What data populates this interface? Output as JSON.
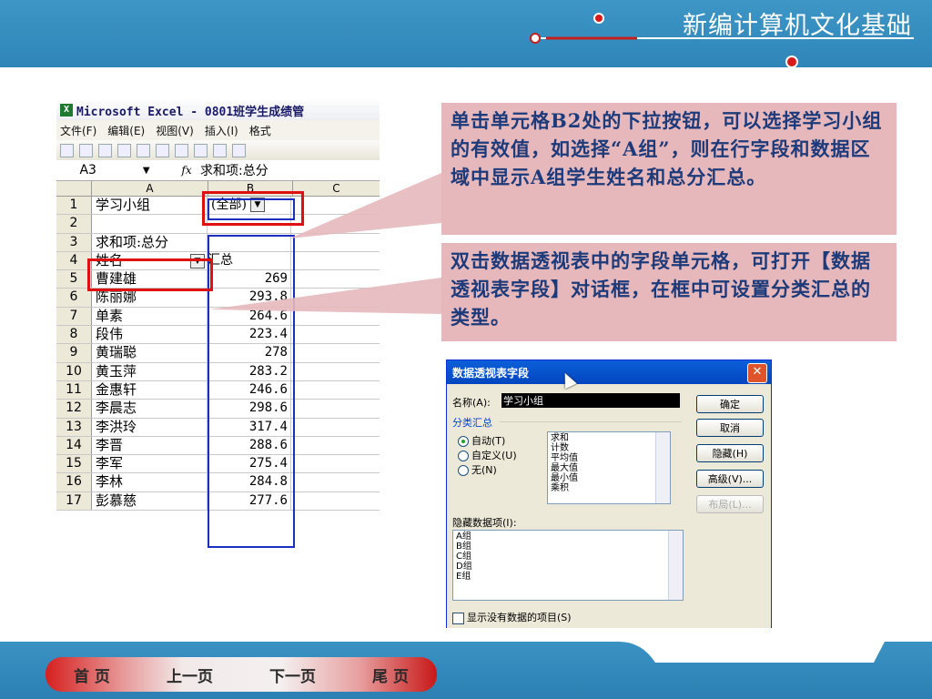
{
  "brand": "新编计算机文化基础",
  "excel": {
    "title": "Microsoft Excel - 0801班学生成绩管",
    "menu": [
      "文件(F)",
      "编辑(E)",
      "视图(V)",
      "插入(I)",
      "格式"
    ],
    "namebox": "A3",
    "formula": "求和项:总分",
    "col_headers": [
      "A",
      "B",
      "C"
    ],
    "rows": [
      {
        "n": "1",
        "a": "学习小组",
        "b": "(全部)"
      },
      {
        "n": "2",
        "a": "",
        "b": ""
      },
      {
        "n": "3",
        "a": "求和项:总分",
        "b": ""
      },
      {
        "n": "4",
        "a": "姓名",
        "b": "汇总"
      },
      {
        "n": "5",
        "a": "曹建雄",
        "b": "269"
      },
      {
        "n": "6",
        "a": "陈丽娜",
        "b": "293.8"
      },
      {
        "n": "7",
        "a": "单素",
        "b": "264.6"
      },
      {
        "n": "8",
        "a": "段伟",
        "b": "223.4"
      },
      {
        "n": "9",
        "a": "黄瑞聪",
        "b": "278"
      },
      {
        "n": "10",
        "a": "黄玉萍",
        "b": "283.2"
      },
      {
        "n": "11",
        "a": "金惠轩",
        "b": "246.6"
      },
      {
        "n": "12",
        "a": "李晨志",
        "b": "298.6"
      },
      {
        "n": "13",
        "a": "李洪玲",
        "b": "317.4"
      },
      {
        "n": "14",
        "a": "李晋",
        "b": "288.6"
      },
      {
        "n": "15",
        "a": "李军",
        "b": "275.4"
      },
      {
        "n": "16",
        "a": "李林",
        "b": "284.8"
      },
      {
        "n": "17",
        "a": "彭慕慈",
        "b": "277.6"
      }
    ]
  },
  "notes": {
    "note1": "单击单元格B2处的下拉按钮，可以选择学习小组的有效值，如选择“A组”，则在行字段和数据区域中显示A组学生姓名和总分汇总。",
    "note2": "双击数据透视表中的字段单元格，可打开【数据透视表字段】对话框，在框中可设置分类汇总的类型。"
  },
  "dialog": {
    "title": "数据透视表字段",
    "name_label": "名称(A):",
    "name_value": "学习小组",
    "subtotal_label": "分类汇总",
    "radio_auto": "自动(T)",
    "radio_custom": "自定义(U)",
    "radio_none": "无(N)",
    "functions": [
      "求和",
      "计数",
      "平均值",
      "最大值",
      "最小值",
      "乘积"
    ],
    "hidden_label": "隐藏数据项(I):",
    "hidden_items": [
      "A组",
      "B组",
      "C组",
      "D组",
      "E组"
    ],
    "show_empty": "显示没有数据的项目(S)",
    "btn_ok": "确定",
    "btn_cancel": "取消",
    "btn_hide": "隐藏(H)",
    "btn_advanced": "高级(V)...",
    "btn_layout": "布局(L)..."
  },
  "nav": {
    "home": "首 页",
    "prev": "上一页",
    "next": "下一页",
    "last": "尾 页"
  },
  "colors": {
    "header_blue": "#3d96c6",
    "note_pink": "#e6b8bb",
    "note_text": "#1d3a7a",
    "highlight_red": "#e01010",
    "pivot_blue": "#1a2fbf"
  }
}
